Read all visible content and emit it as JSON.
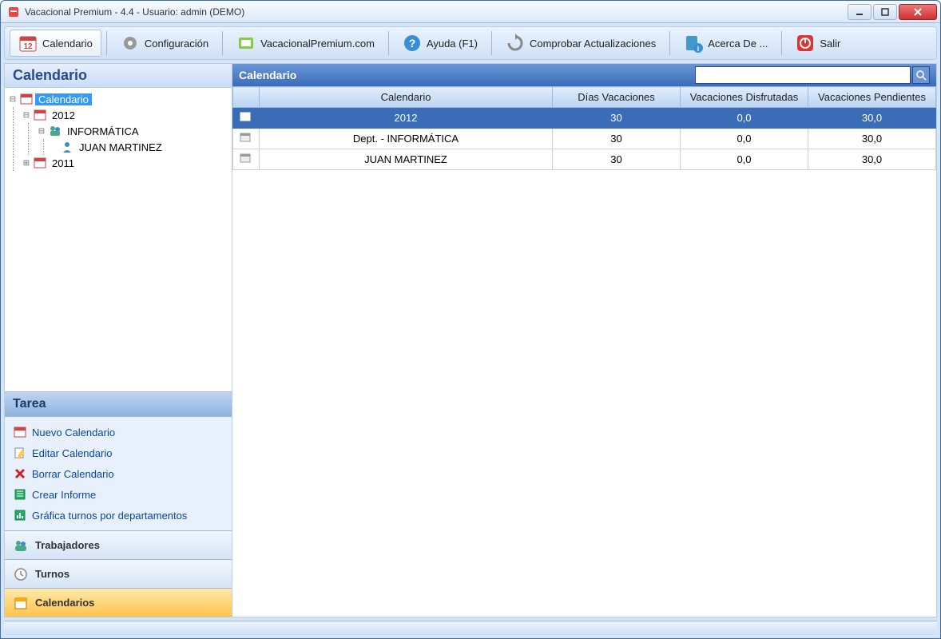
{
  "window": {
    "title": "Vacacional Premium - 4.4 - Usuario: admin (DEMO)"
  },
  "toolbar": {
    "calendario": "Calendario",
    "configuracion": "Configuración",
    "website": "VacacionalPremium.com",
    "ayuda": "Ayuda (F1)",
    "actualizaciones": "Comprobar Actualizaciones",
    "acerca": "Acerca De ...",
    "salir": "Salir"
  },
  "sidebar": {
    "header": "Calendario",
    "tree": {
      "root": "Calendario",
      "y2012": "2012",
      "dept": "INFORMÁTICA",
      "person": "JUAN MARTINEZ",
      "y2011": "2011"
    },
    "tarea_header": "Tarea",
    "tarea": {
      "nuevo": "Nuevo Calendario",
      "editar": "Editar Calendario",
      "borrar": "Borrar Calendario",
      "informe": "Crear Informe",
      "grafica": "Gráfica turnos por departamentos"
    },
    "nav": {
      "trabajadores": "Trabajadores",
      "turnos": "Turnos",
      "calendarios": "Calendarios"
    }
  },
  "main": {
    "header": "Calendario",
    "columns": {
      "c1": "Calendario",
      "c2": "Días Vacaciones",
      "c3": "Vacaciones Disfrutadas",
      "c4": "Vacaciones Pendientes"
    },
    "rows": [
      {
        "name": "2012",
        "dias": "30",
        "disf": "0,0",
        "pend": "30,0"
      },
      {
        "name": "Dept. - INFORMÁTICA",
        "dias": "30",
        "disf": "0,0",
        "pend": "30,0"
      },
      {
        "name": "JUAN MARTINEZ",
        "dias": "30",
        "disf": "0,0",
        "pend": "30,0"
      }
    ]
  }
}
